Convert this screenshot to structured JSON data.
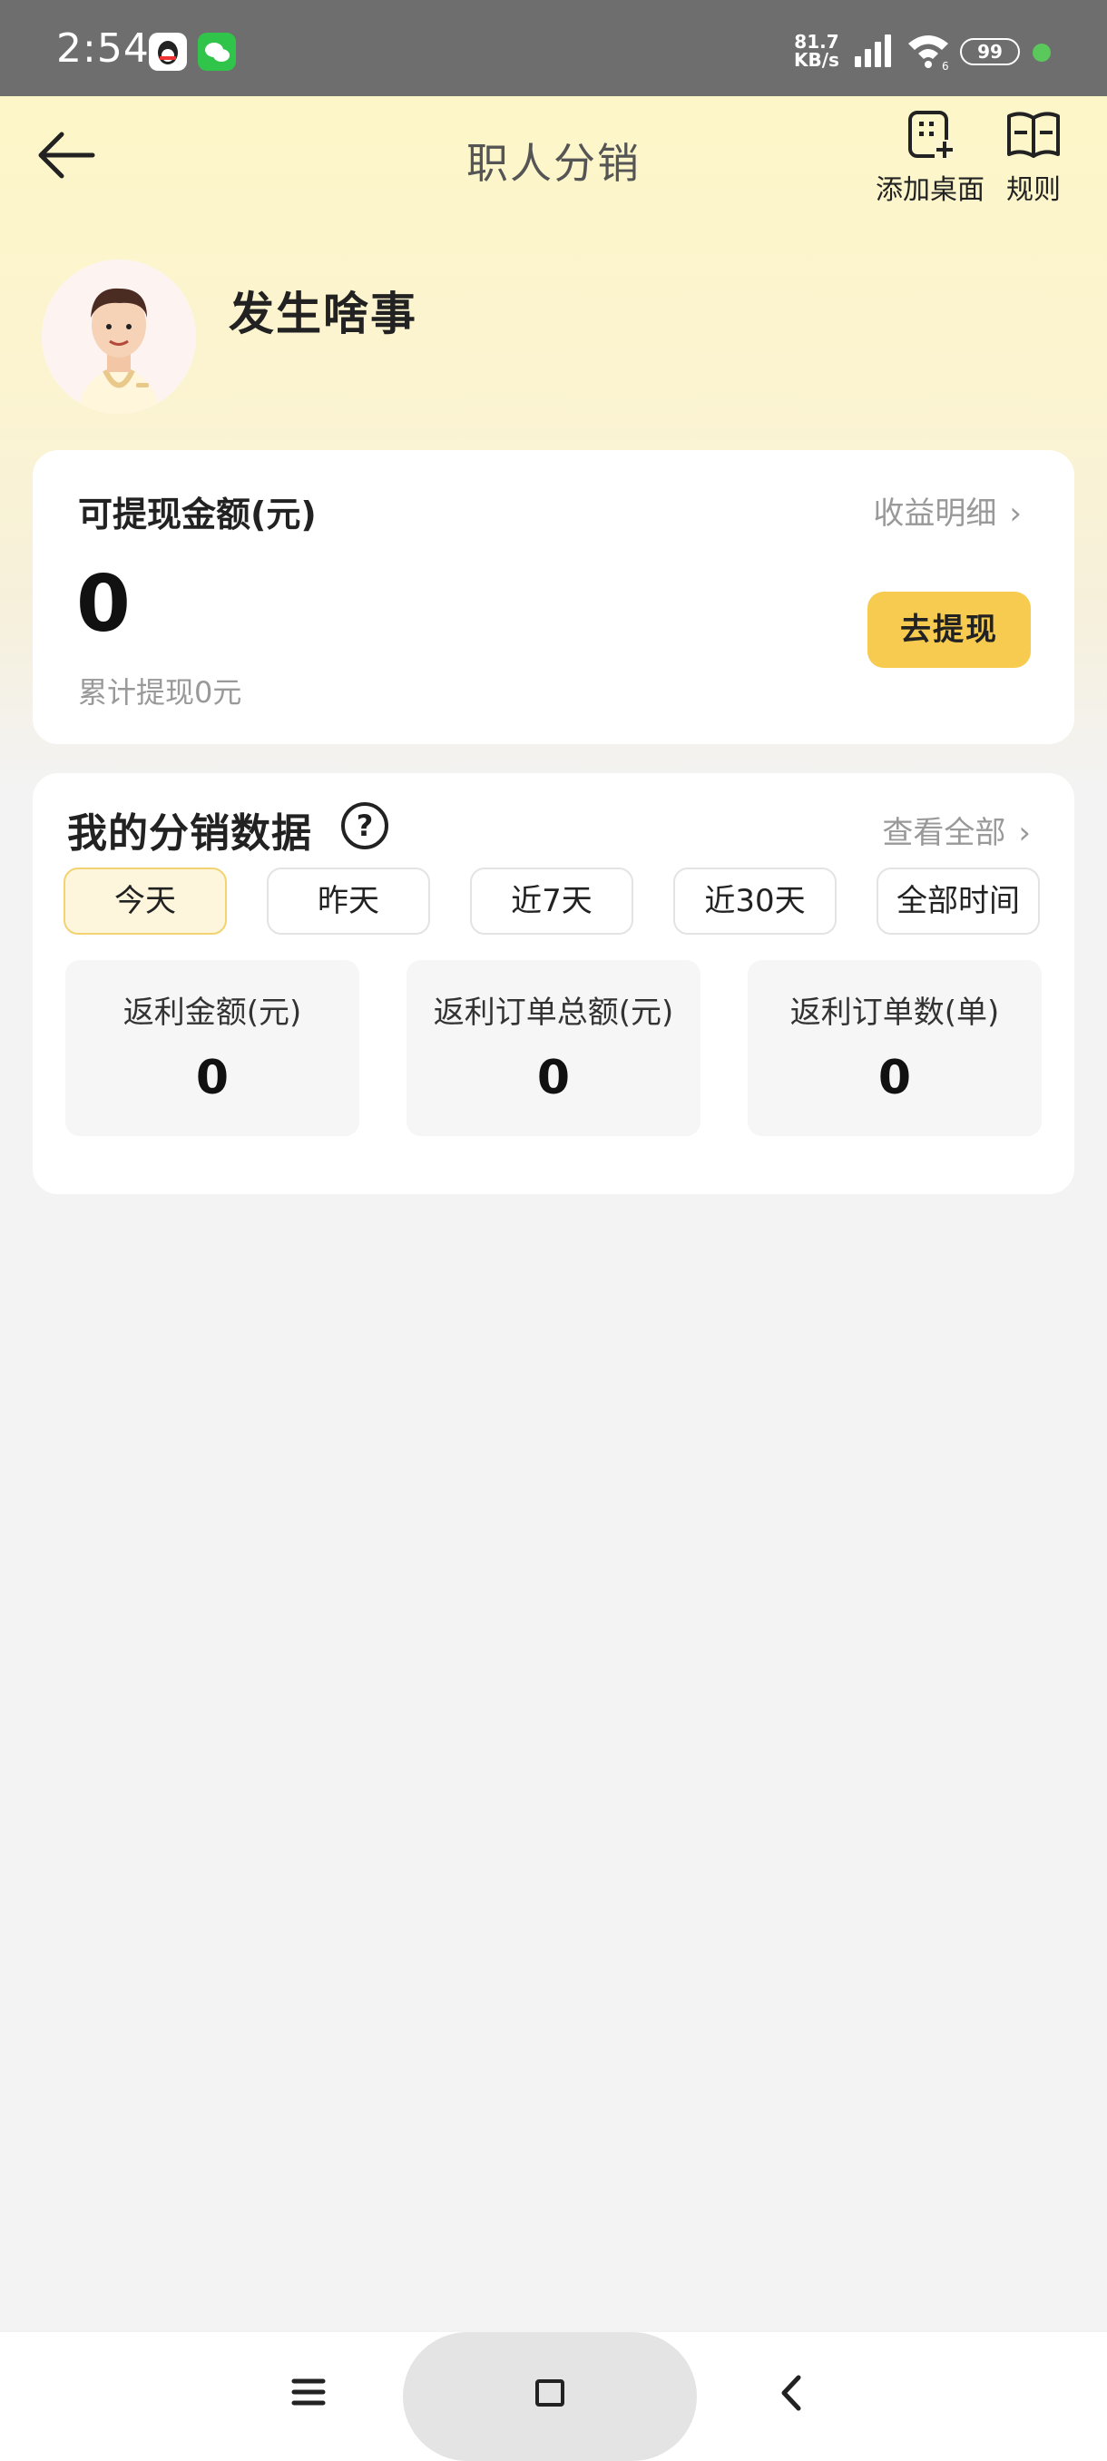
{
  "status_bar": {
    "time": "2:54",
    "net_speed_value": "81.7",
    "net_speed_unit": "KB/s",
    "battery": "99",
    "wifi_badge": "6",
    "app_icons": [
      "qq-icon",
      "wechat-icon"
    ]
  },
  "nav": {
    "title": "职人分销",
    "add_to_desktop": "添加桌面",
    "rules": "规则"
  },
  "profile": {
    "name": "发生啥事"
  },
  "balance": {
    "label": "可提现金额(元)",
    "detail_link": "收益明细",
    "amount": "0",
    "cumulative": "累计提现0元",
    "withdraw_button": "去提现"
  },
  "distribution": {
    "title": "我的分销数据",
    "view_all": "查看全部",
    "tabs": [
      {
        "label": "今天",
        "active": true
      },
      {
        "label": "昨天",
        "active": false
      },
      {
        "label": "近7天",
        "active": false
      },
      {
        "label": "近30天",
        "active": false
      },
      {
        "label": "全部时间",
        "active": false
      }
    ],
    "stats": [
      {
        "label": "返利金额(元)",
        "value": "0"
      },
      {
        "label": "返利订单总额(元)",
        "value": "0"
      },
      {
        "label": "返利订单数(单)",
        "value": "0"
      }
    ]
  },
  "colors": {
    "accent": "#f6cb4f",
    "hero_top": "#fdf6c8",
    "background": "#f3f3f3"
  }
}
